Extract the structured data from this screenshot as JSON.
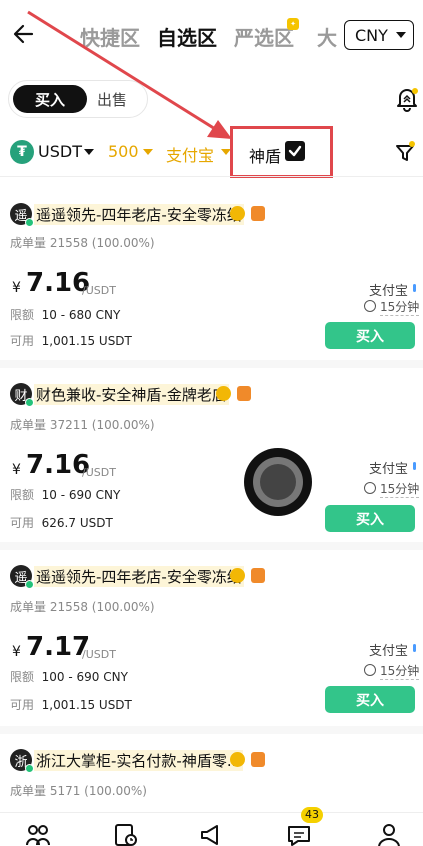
{
  "header": {
    "tabs": [
      {
        "label": "快捷区"
      },
      {
        "label": "自选区"
      },
      {
        "label": "严选区"
      },
      {
        "label": "大"
      }
    ],
    "currency": "CNY"
  },
  "trade_toggle": {
    "buy": "买入",
    "sell": "出售"
  },
  "filters": {
    "coin": "USDT",
    "amount": "500",
    "payment": "支付宝",
    "shield_label": "神盾",
    "shield_checked": true
  },
  "ads": [
    {
      "avatar": "遥",
      "merchant": "遥遥领先-四年老店-安全零冻结",
      "stats": "成单量 21558 (100.00%)",
      "currency_symbol": "¥",
      "price": "7.16",
      "unit": "/USDT",
      "limit_label": "限额",
      "limit": "10 - 680 CNY",
      "avail_label": "可用",
      "available": "1,001.15 USDT",
      "method": "支付宝",
      "time": "15分钟",
      "button": "买入"
    },
    {
      "avatar": "财",
      "merchant": "财色兼收-安全神盾-金牌老店",
      "stats": "成单量 37211 (100.00%)",
      "currency_symbol": "¥",
      "price": "7.16",
      "unit": "/USDT",
      "limit_label": "限额",
      "limit": "10 - 690 CNY",
      "avail_label": "可用",
      "available": "626.7 USDT",
      "method": "支付宝",
      "time": "15分钟",
      "button": "买入"
    },
    {
      "avatar": "遥",
      "merchant": "遥遥领先-四年老店-安全零冻结",
      "stats": "成单量 21558 (100.00%)",
      "currency_symbol": "¥",
      "price": "7.17",
      "unit": "/USDT",
      "limit_label": "限额",
      "limit": "100 - 690 CNY",
      "avail_label": "可用",
      "available": "1,001.15 USDT",
      "method": "支付宝",
      "time": "15分钟",
      "button": "买入"
    },
    {
      "avatar": "浙",
      "merchant": "浙江大掌柜-实名付款-神盾零...",
      "stats": "成单量 5171 (100.00%)"
    }
  ],
  "bottom_nav": {
    "messages_count": "43"
  },
  "icons": [
    "back-arrow-icon",
    "bell-icon",
    "filter-icon",
    "tether-icon",
    "check-icon",
    "clock-icon",
    "p2p-icon",
    "orders-icon",
    "megaphone-icon",
    "chat-icon",
    "profile-icon"
  ],
  "colors": {
    "accent_yellow": "#e6a700",
    "buy_green": "#33c58a",
    "annotation_red": "#e0474c",
    "tether_green": "#26a17b"
  }
}
